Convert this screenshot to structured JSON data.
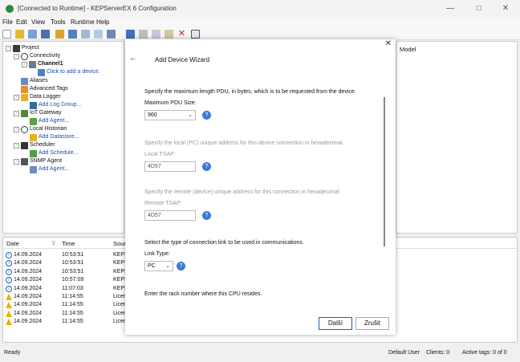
{
  "window": {
    "title": "[Connected to Runtime] - KEPServerEX 6 Configuration"
  },
  "menu": [
    "File",
    "Edit",
    "View",
    "Tools",
    "Runtime",
    "Help"
  ],
  "tree": {
    "project": "Project",
    "connectivity": "Connectivity",
    "channel": "Channel1",
    "add_device": "Click to add a device.",
    "aliases": "Aliases",
    "advanced_tags": "Advanced Tags",
    "data_logger": "Data Logger",
    "add_log_group": "Add Log Group...",
    "iot_gateway": "IoT Gateway",
    "add_agent": "Add Agent...",
    "local_historian": "Local Historian",
    "add_datastore": "Add Datastore...",
    "scheduler": "Scheduler",
    "add_schedule": "Add Schedule...",
    "snmp_agent": "SNMP Agent",
    "add_agent2": "Add Agent..."
  },
  "right_pane": {
    "header": "Model"
  },
  "log": {
    "headers": [
      "Date",
      "Time",
      "Sourc"
    ],
    "rows": [
      {
        "type": "info",
        "date": "14.09.2024",
        "time": "10:53:51",
        "source": "KEPS"
      },
      {
        "type": "info",
        "date": "14.09.2024",
        "time": "10:53:51",
        "source": "KEPS"
      },
      {
        "type": "info",
        "date": "14.09.2024",
        "time": "10:53:51",
        "source": "KEPS"
      },
      {
        "type": "info",
        "date": "14.09.2024",
        "time": "10:57:09",
        "source": "KEPS"
      },
      {
        "type": "info",
        "date": "14.09.2024",
        "time": "11:07:03",
        "source": "KEPS"
      },
      {
        "type": "warn",
        "date": "14.09.2024",
        "time": "11:14:55",
        "source": "Licen"
      },
      {
        "type": "warn",
        "date": "14.09.2024",
        "time": "11:14:55",
        "source": "Licen"
      },
      {
        "type": "warn",
        "date": "14.09.2024",
        "time": "11:14:55",
        "source": "Licen"
      },
      {
        "type": "warn",
        "date": "14.09.2024",
        "time": "11:14:55",
        "source": "Licen"
      }
    ]
  },
  "status": {
    "left": "Ready",
    "user": "Default User",
    "clients": "Clients: 0",
    "tags": "Active tags: 0 of 0"
  },
  "dialog": {
    "title": "Add Device Wizard",
    "pdu_desc": "Specify the maximum length PDU, in bytes, which is to be requested from the device.",
    "pdu_label": "Maximum PDU Size:",
    "pdu_value": "960",
    "local_desc": "Specify the local (PC) unique address for this device connection in hexadecimal.",
    "local_label": "Local TSAP:",
    "local_value": "4D57",
    "remote_desc": "Specify the remote (device) unique address for this connection in hexadecimal.",
    "remote_label": "Remote TSAP:",
    "remote_value": "4D57",
    "link_desc": "Select the type of connection link to be used in communications.",
    "link_label": "Link Type:",
    "link_value": "PC",
    "rack_desc": "Enter the rack number where this CPU resides.",
    "next_button": "Další",
    "cancel_button": "Zrušit"
  },
  "colors": {
    "accent": "#1e5fbf",
    "help_icon": "#3a7bd5",
    "warning": "#f0b000"
  }
}
